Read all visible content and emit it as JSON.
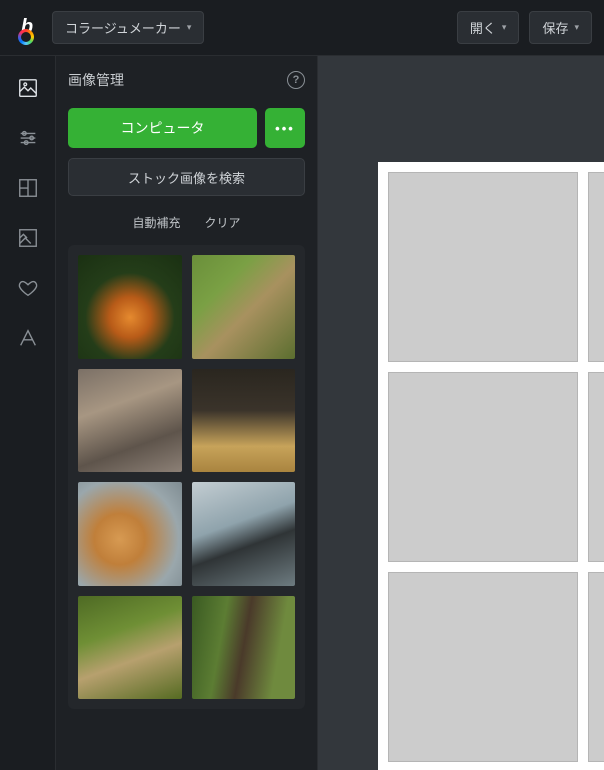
{
  "topbar": {
    "mode_label": "コラージュメーカー",
    "open_label": "開く",
    "save_label": "保存"
  },
  "rail": {
    "items": [
      {
        "name": "image-manager",
        "icon": "image"
      },
      {
        "name": "adjust",
        "icon": "sliders"
      },
      {
        "name": "layouts",
        "icon": "layout"
      },
      {
        "name": "background",
        "icon": "background"
      },
      {
        "name": "favorites",
        "icon": "heart"
      },
      {
        "name": "text",
        "icon": "text"
      }
    ]
  },
  "panel": {
    "title": "画像管理",
    "upload_label": "コンピュータ",
    "more_label": "•••",
    "stock_search_label": "ストック画像を検索",
    "autofill_label": "自動補充",
    "clear_label": "クリア",
    "thumbs": [
      {
        "name": "tiger",
        "class": "t-tiger"
      },
      {
        "name": "kitten-grass",
        "class": "t-kitten-grass"
      },
      {
        "name": "tabby-sleep",
        "class": "t-tabby-sleep"
      },
      {
        "name": "three-kittens",
        "class": "t-three-kittens"
      },
      {
        "name": "orange-kitten",
        "class": "t-orange-kitten"
      },
      {
        "name": "bw-kitten",
        "class": "t-bw-kitten"
      },
      {
        "name": "kitten-lookup",
        "class": "t-kitten-lookup"
      },
      {
        "name": "cat-tree",
        "class": "t-cat-tree"
      }
    ]
  },
  "collage": {
    "slots": 6
  }
}
